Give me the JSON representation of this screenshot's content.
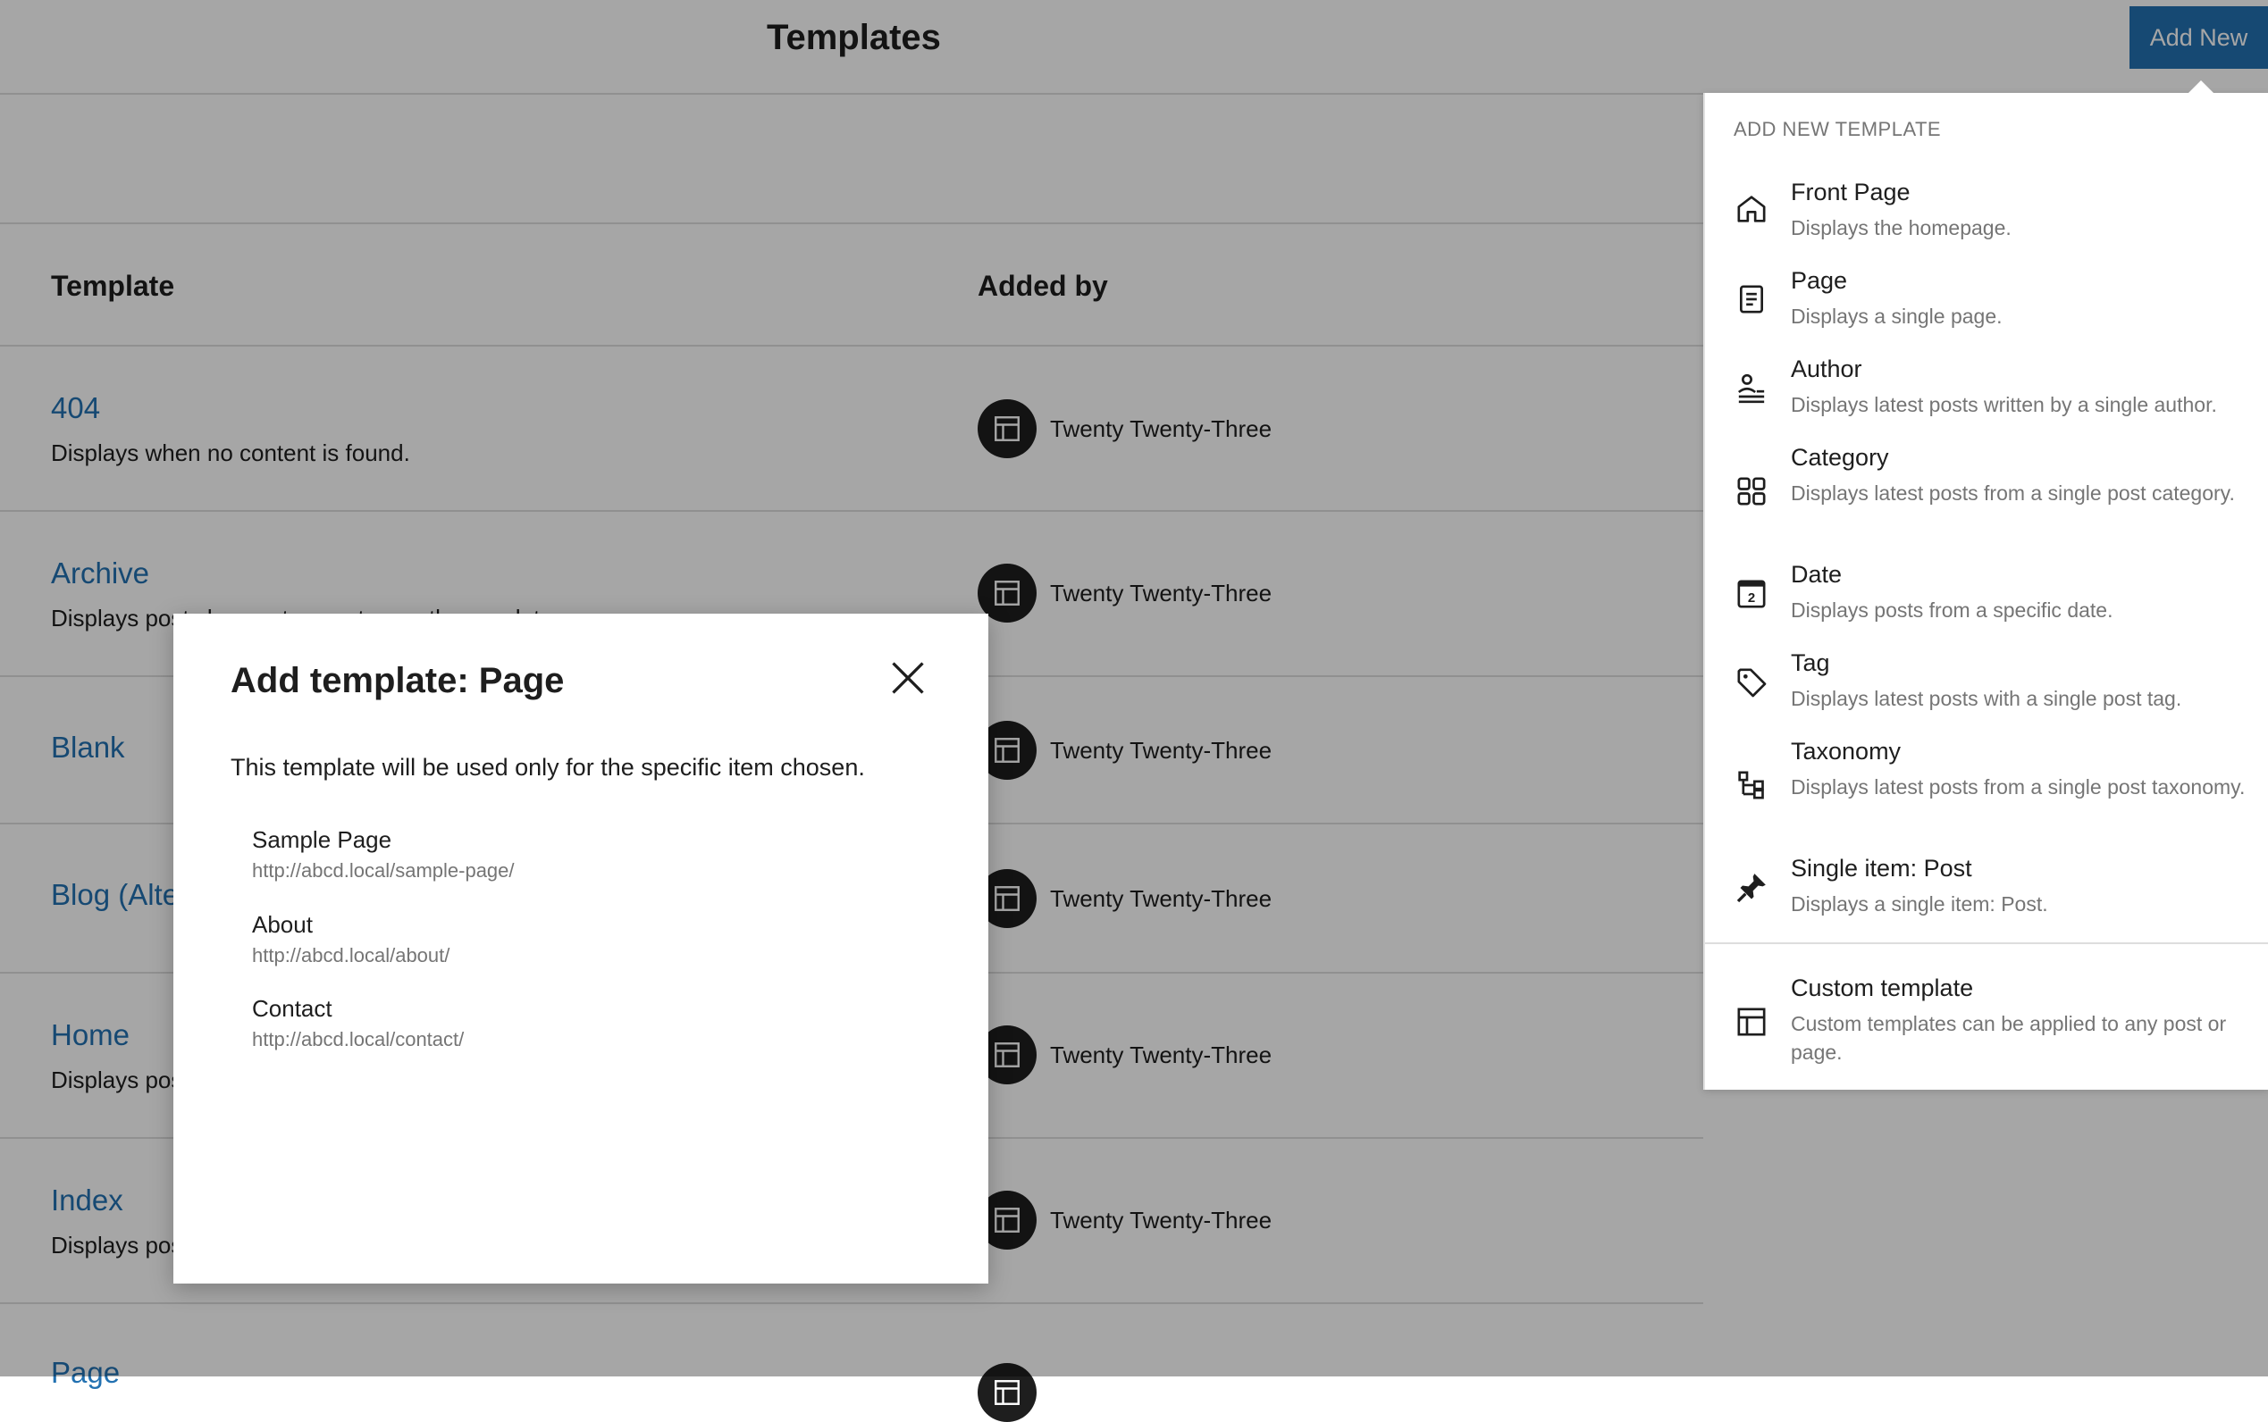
{
  "header": {
    "title": "Templates",
    "add_new_label": "Add New"
  },
  "table": {
    "columns": [
      "Template",
      "Added by"
    ],
    "rows": [
      {
        "title": "404",
        "description": "Displays when no content is found.",
        "added_by": "Twenty Twenty-Three"
      },
      {
        "title": "Archive",
        "description": "Displays posts by a category, tag, author, or date.",
        "added_by": "Twenty Twenty-Three"
      },
      {
        "title": "Blank",
        "description": "",
        "added_by": "Twenty Twenty-Three"
      },
      {
        "title": "Blog (Alternative)",
        "description": "",
        "added_by": "Twenty Twenty-Three"
      },
      {
        "title": "Home",
        "description": "Displays posts on the homepage.",
        "added_by": "Twenty Twenty-Three"
      },
      {
        "title": "Index",
        "description": "Displays posts.",
        "added_by": "Twenty Twenty-Three"
      },
      {
        "title": "Page",
        "description": "",
        "added_by": ""
      }
    ]
  },
  "dropdown": {
    "heading": "ADD NEW TEMPLATE",
    "items": [
      {
        "label": "Front Page",
        "description": "Displays the homepage.",
        "icon": "home-icon"
      },
      {
        "label": "Page",
        "description": "Displays a single page.",
        "icon": "page-icon"
      },
      {
        "label": "Author",
        "description": "Displays latest posts written by a single author.",
        "icon": "author-icon"
      },
      {
        "label": "Category",
        "description": "Displays latest posts from a single post category.",
        "icon": "category-icon"
      },
      {
        "label": "Date",
        "description": "Displays posts from a specific date.",
        "icon": "calendar-icon"
      },
      {
        "label": "Tag",
        "description": "Displays latest posts with a single post tag.",
        "icon": "tag-icon"
      },
      {
        "label": "Taxonomy",
        "description": "Displays latest posts from a single post taxonomy.",
        "icon": "taxonomy-icon"
      },
      {
        "label": "Single item: Post",
        "description": "Displays a single item: Post.",
        "icon": "pin-icon"
      }
    ],
    "custom": {
      "label": "Custom template",
      "description": "Custom templates can be applied to any post or page.",
      "icon": "layout-icon"
    },
    "date_icon_text": "2"
  },
  "modal": {
    "title": "Add template: Page",
    "help": "This template will be used only for the specific item chosen.",
    "items": [
      {
        "title": "Sample Page",
        "url": "http://abcd.local/sample-page/"
      },
      {
        "title": "About",
        "url": "http://abcd.local/about/"
      },
      {
        "title": "Contact",
        "url": "http://abcd.local/contact/"
      }
    ]
  }
}
